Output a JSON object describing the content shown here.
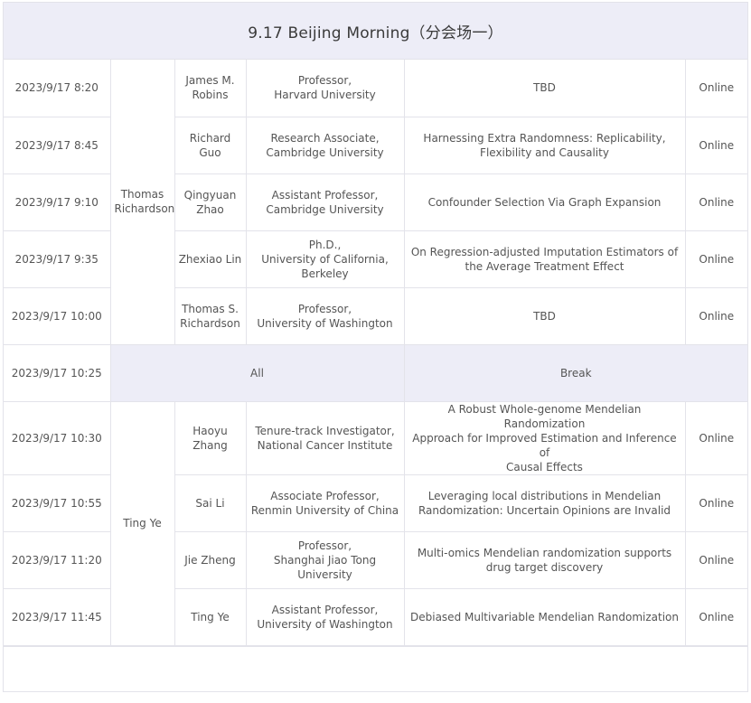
{
  "header": {
    "title": "9.17 Beijing Morning（分会场一）"
  },
  "chairs": {
    "first": "Thomas\nRichardson",
    "second": "Ting Ye"
  },
  "rows": [
    {
      "time": "2023/9/17 8:20",
      "speaker": "James M.\nRobins",
      "affiliation": "Professor,\nHarvard University",
      "title": "TBD",
      "mode": "Online"
    },
    {
      "time": "2023/9/17 8:45",
      "speaker": "Richard Guo",
      "affiliation": "Research Associate,\nCambridge University",
      "title": "Harnessing Extra Randomness: Replicability,\nFlexibility and Causality",
      "mode": "Online"
    },
    {
      "time": "2023/9/17 9:10",
      "speaker": "Qingyuan\nZhao",
      "affiliation": "Assistant Professor,\nCambridge University",
      "title": "Confounder Selection Via Graph Expansion",
      "mode": "Online"
    },
    {
      "time": "2023/9/17 9:35",
      "speaker": "Zhexiao Lin",
      "affiliation": "Ph.D.,\nUniversity of California,\nBerkeley",
      "title": "On Regression-adjusted Imputation Estimators of\nthe Average Treatment Effect",
      "mode": "Online"
    },
    {
      "time": "2023/9/17 10:00",
      "speaker": "Thomas S.\nRichardson",
      "affiliation": "Professor,\nUniversity of Washington",
      "title": "TBD",
      "mode": "Online"
    }
  ],
  "break_row": {
    "time": "2023/9/17 10:25",
    "who": "All",
    "label": "Break"
  },
  "rows2": [
    {
      "time": "2023/9/17 10:30",
      "speaker": "Haoyu\nZhang",
      "affiliation": "Tenure-track Investigator,\nNational Cancer Institute",
      "title": "A Robust Whole-genome Mendelian Randomization\nApproach for Improved Estimation and Inference of\nCausal Effects",
      "mode": "Online"
    },
    {
      "time": "2023/9/17 10:55",
      "speaker": "Sai Li",
      "affiliation": "Associate Professor,\nRenmin University of China",
      "title": "Leveraging local distributions in Mendelian\nRandomization: Uncertain Opinions are Invalid",
      "mode": "Online"
    },
    {
      "time": "2023/9/17 11:20",
      "speaker": "Jie Zheng",
      "affiliation": "Professor,\nShanghai Jiao Tong\nUniversity",
      "title": "Multi-omics Mendelian randomization supports\ndrug target discovery",
      "mode": "Online"
    },
    {
      "time": "2023/9/17 11:45",
      "speaker": "Ting Ye",
      "affiliation": "Assistant Professor,\nUniversity of Washington",
      "title": "Debiased Multivariable Mendelian Randomization",
      "mode": "Online"
    }
  ]
}
